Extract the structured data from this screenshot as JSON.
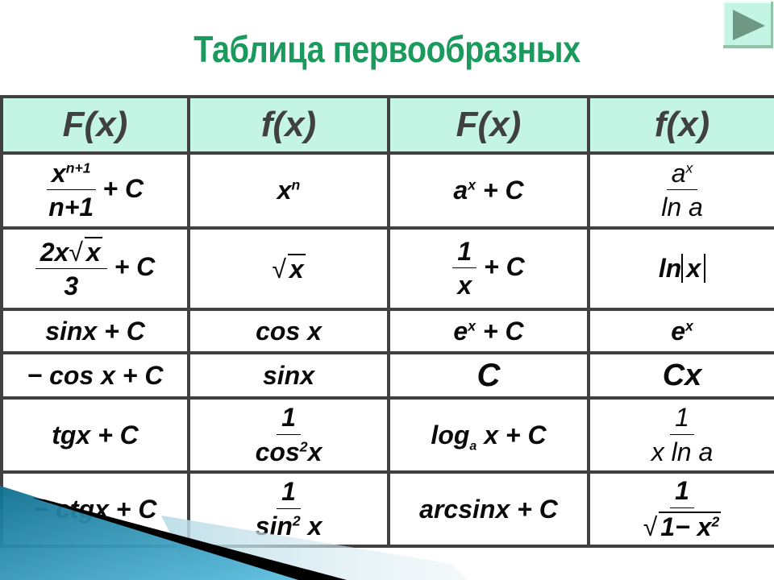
{
  "title": "Таблица первообразных",
  "nav": {
    "next_icon": "play-triangle-icon"
  },
  "colors": {
    "title": "#1a9a5c",
    "header_bg": "#c4f5e4",
    "border": "#404040"
  },
  "headers": [
    "F(x)",
    "f(x)",
    "F(x)",
    "f(x)"
  ],
  "rows": [
    {
      "F1": {
        "num_base": "x",
        "num_exp": "n+1",
        "den": "n+1",
        "tail": "+ C"
      },
      "f1": {
        "base": "x",
        "exp": "n"
      },
      "F2": {
        "base": "a",
        "exp": "x",
        "tail": "+ C"
      },
      "f2": {
        "num_base": "a",
        "num_exp": "x",
        "den": "ln a"
      }
    },
    {
      "F1": {
        "num_pre": "2x",
        "num_rad": "x",
        "den": "3",
        "tail": "+ C"
      },
      "f1": {
        "rad": "x"
      },
      "F2": {
        "num": "1",
        "den": "x",
        "tail": "+ C"
      },
      "f2": {
        "pre": "ln",
        "abs": "x"
      }
    },
    {
      "F1": "sinx + C",
      "f1": "cos x",
      "F2": {
        "base": "e",
        "exp": "x",
        "tail": "+ C"
      },
      "f2": {
        "base": "e",
        "exp": "x"
      }
    },
    {
      "F1": "− cos x + C",
      "f1": "sinx",
      "F2": "C",
      "f2": "Cx"
    },
    {
      "F1": "tgx + C",
      "f1": {
        "num": "1",
        "den_base": "cos",
        "den_exp": "2",
        "den_tail": "x"
      },
      "F2": {
        "pre": "log",
        "sub": "a",
        "tail": "x + C"
      },
      "f2": {
        "num": "1",
        "den": "x ln a"
      }
    },
    {
      "F1": "− ctgx + C",
      "f1": {
        "num": "1",
        "den_base": "sin",
        "den_exp": "2",
        "den_tail": "x"
      },
      "F2": "arcsinx + C",
      "f2": {
        "num": "1",
        "den_pre": "1− x",
        "den_exp": "2"
      }
    }
  ]
}
